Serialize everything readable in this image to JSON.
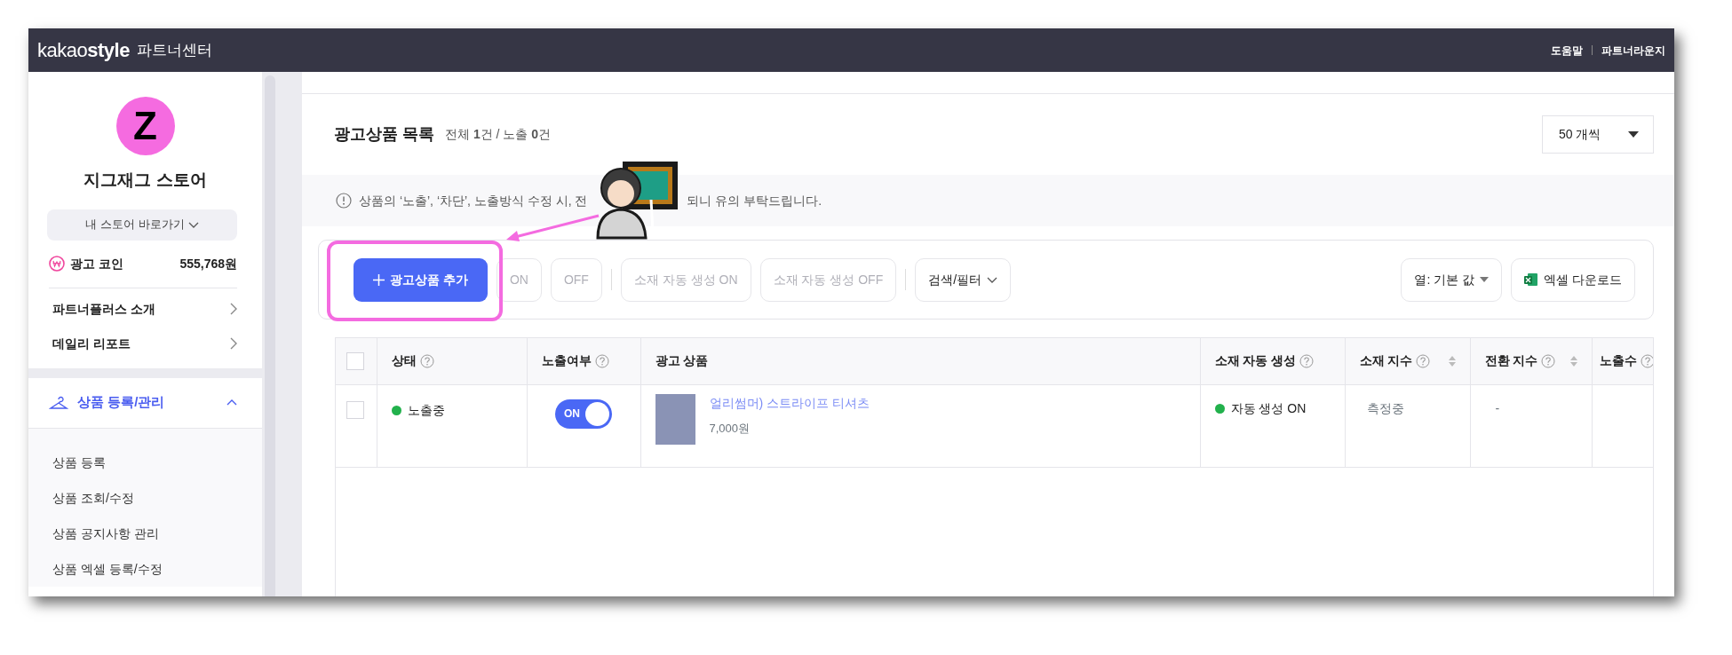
{
  "header": {
    "logo": "kakao**style**",
    "product": "파트너센터",
    "links": [
      "도움말",
      "파트너라운지"
    ]
  },
  "sidebar": {
    "avatar_letter": "Z",
    "store_name": "지그재그 스토어",
    "store_button": "내 스토어 바로가기",
    "coin": {
      "label": "광고 코인",
      "value": "555,768원"
    },
    "links": [
      "파트너플러스 소개",
      "데일리 리포트"
    ],
    "section": {
      "label": "상품 등록/관리",
      "expanded": true,
      "items": [
        "상품 등록",
        "상품 조회/수정",
        "상품 공지사항 관리",
        "상품 엑셀 등록/수정"
      ]
    }
  },
  "list": {
    "title": "광고상품 목록",
    "summary": "전체 **1**건 / 노출 **0**건",
    "page_size": "50 개씩"
  },
  "notice": {
    "text_before": "상품의 ‘노출’, ‘차단’, 노출방식 수정 시, 전",
    "text_after": "되니 유의 부탁드립니다."
  },
  "toolbar": {
    "add_button": "광고상품 추가",
    "buttons": [
      {
        "label": "ON",
        "disabled": true
      },
      {
        "label": "OFF",
        "disabled": true
      },
      {
        "label": "소재 자동 생성 ON",
        "disabled": true
      },
      {
        "label": "소재 자동 생성 OFF",
        "disabled": true
      }
    ],
    "filter_button": "검색/필터",
    "column_select": "열: 기본 값",
    "excel_button": "엑셀 다운로드"
  },
  "table": {
    "all_selected": false,
    "columns": [
      {
        "label": "상태",
        "help": true,
        "sortable": false
      },
      {
        "label": "노출여부",
        "help": true,
        "sortable": false
      },
      {
        "label": "광고 상품",
        "help": false,
        "sortable": false
      },
      {
        "label": "소재 자동 생성",
        "help": true,
        "sortable": false
      },
      {
        "label": "소재 지수",
        "help": true,
        "sortable": true
      },
      {
        "label": "전환 지수",
        "help": true,
        "sortable": true
      },
      {
        "label": "노출수",
        "help": true,
        "sortable": false
      }
    ],
    "rows": [
      {
        "selected": false,
        "status": "노출중",
        "exposed": {
          "on": true,
          "label": "ON"
        },
        "product": "얼리썸머) 스트라이프 티셔츠",
        "price": "7,000원",
        "auto_generation": "자동 생성 ON",
        "creative_index": "측정중",
        "conversion_index": "-"
      }
    ]
  }
}
